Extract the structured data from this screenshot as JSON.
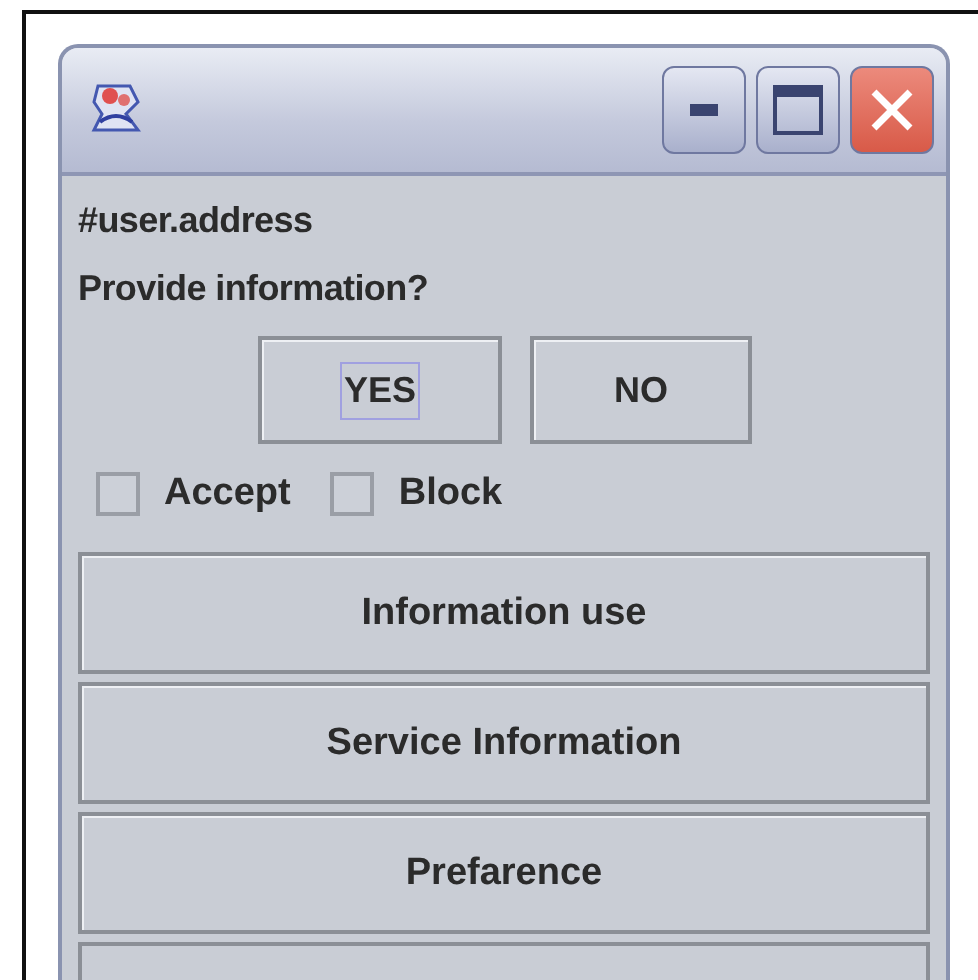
{
  "window": {
    "controls": [
      {
        "kind": "minimize"
      },
      {
        "kind": "maximize"
      },
      {
        "kind": "close"
      }
    ]
  },
  "lines": [
    "#user.address",
    "Provide information?"
  ],
  "answer_buttons": [
    {
      "label": "YES",
      "focused": true
    },
    {
      "label": "NO",
      "focused": false
    }
  ],
  "checkboxes": [
    {
      "label": "Accept",
      "checked": false
    },
    {
      "label": "Block",
      "checked": false
    }
  ],
  "sections": [
    "Information use",
    "Service Information",
    "Prefarence"
  ]
}
